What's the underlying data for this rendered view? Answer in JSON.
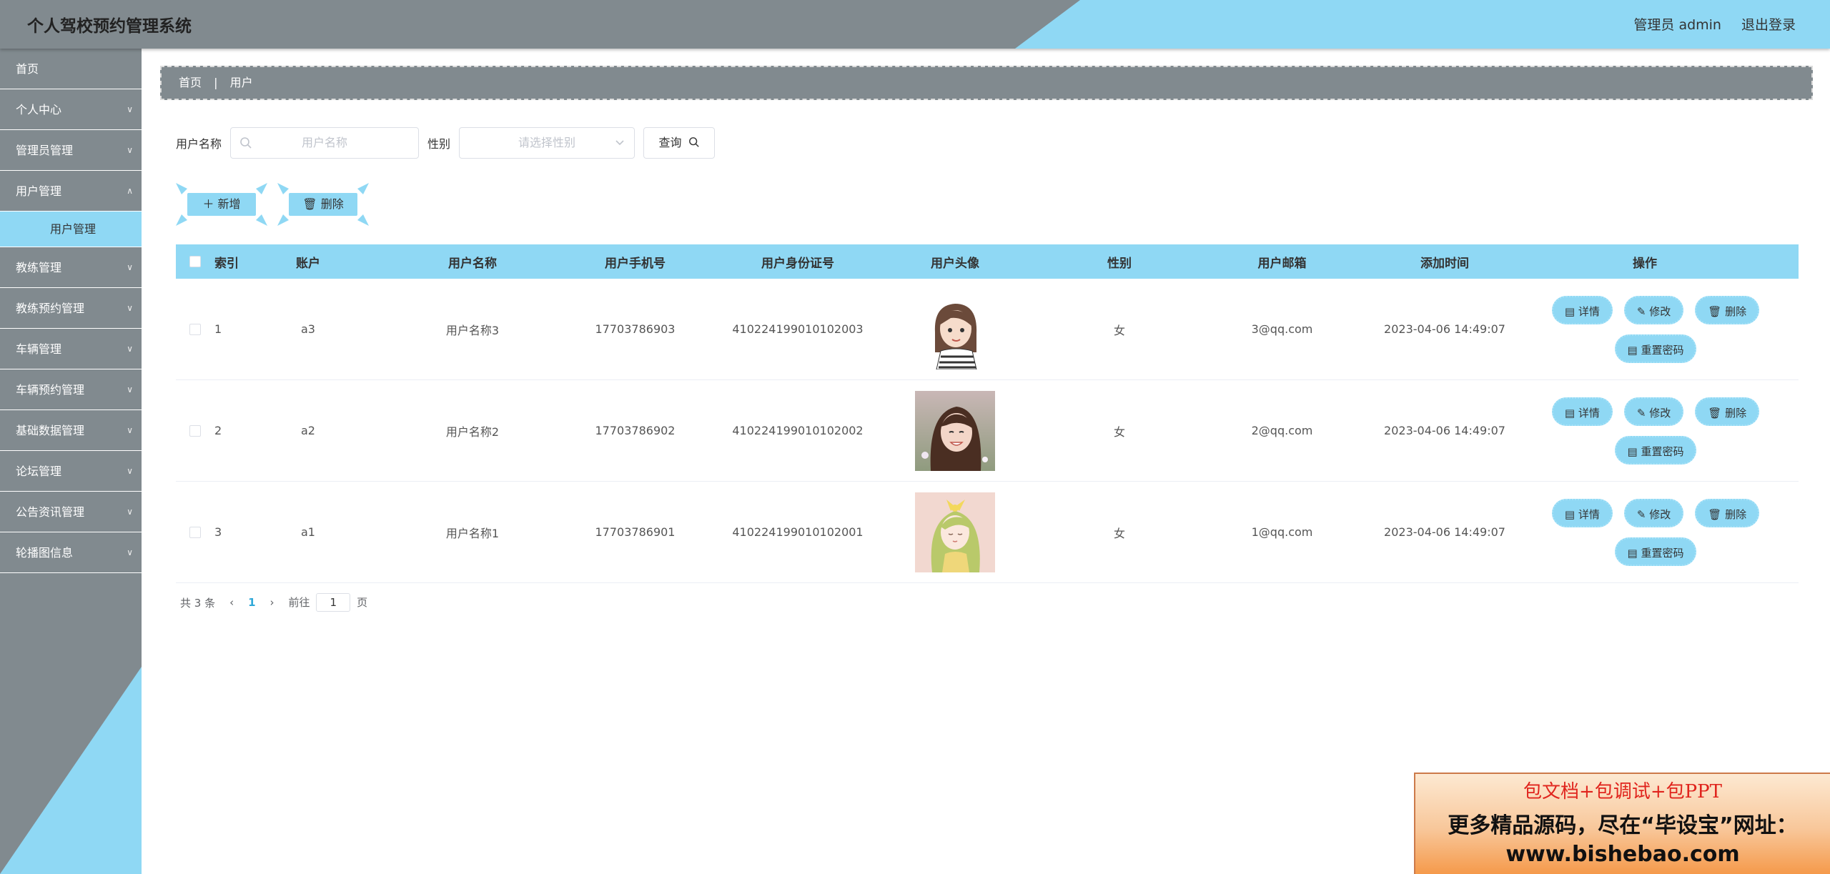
{
  "header": {
    "title": "个人驾校预约管理系统",
    "admin_label": "管理员 admin",
    "logout_label": "退出登录"
  },
  "sidebar": {
    "items": [
      {
        "label": "首页",
        "chevron": false
      },
      {
        "label": "个人中心",
        "chevron": true
      },
      {
        "label": "管理员管理",
        "chevron": true
      },
      {
        "label": "用户管理",
        "chevron": true
      },
      {
        "label": "用户管理",
        "sub": true
      },
      {
        "label": "教练管理",
        "chevron": true
      },
      {
        "label": "教练预约管理",
        "chevron": true
      },
      {
        "label": "车辆管理",
        "chevron": true
      },
      {
        "label": "车辆预约管理",
        "chevron": true
      },
      {
        "label": "基础数据管理",
        "chevron": true
      },
      {
        "label": "论坛管理",
        "chevron": true
      },
      {
        "label": "公告资讯管理",
        "chevron": true
      },
      {
        "label": "轮播图信息",
        "chevron": true
      }
    ]
  },
  "breadcrumb": {
    "home": "首页",
    "sep": "|",
    "current": "用户"
  },
  "search": {
    "username_label": "用户名称",
    "username_placeholder": "用户名称",
    "gender_label": "性别",
    "gender_placeholder": "请选择性别",
    "query_label": "查询"
  },
  "actions": {
    "add_label": "新增",
    "delete_label": "删除"
  },
  "table": {
    "headers": [
      "索引",
      "账户",
      "用户名称",
      "用户手机号",
      "用户身份证号",
      "用户头像",
      "性别",
      "用户邮箱",
      "添加时间",
      "操作"
    ],
    "rows": [
      {
        "index": "1",
        "account": "a3",
        "name": "用户名称3",
        "phone": "17703786903",
        "idcard": "410224199010102003",
        "gender": "女",
        "email": "3@qq.com",
        "time": "2023-04-06 14:49:07"
      },
      {
        "index": "2",
        "account": "a2",
        "name": "用户名称2",
        "phone": "17703786902",
        "idcard": "410224199010102002",
        "gender": "女",
        "email": "2@qq.com",
        "time": "2023-04-06 14:49:07"
      },
      {
        "index": "3",
        "account": "a1",
        "name": "用户名称1",
        "phone": "17703786901",
        "idcard": "410224199010102001",
        "gender": "女",
        "email": "1@qq.com",
        "time": "2023-04-06 14:49:07"
      }
    ],
    "ops": {
      "detail": "详情",
      "edit": "修改",
      "delete": "删除",
      "reset": "重置密码"
    }
  },
  "pager": {
    "total": "共 3 条",
    "current_page": "1",
    "goto_prefix": "前往",
    "goto_value": "1",
    "goto_suffix": "页"
  },
  "promo": {
    "line1": "包文档+包调试+包PPT",
    "line2": "更多精品源码，尽在“毕设宝”网址：",
    "line3": "www.bishebao.com"
  },
  "colors": {
    "accent": "#8fd8f4",
    "chrome": "#818a8f",
    "promo_red": "#e0241d"
  }
}
